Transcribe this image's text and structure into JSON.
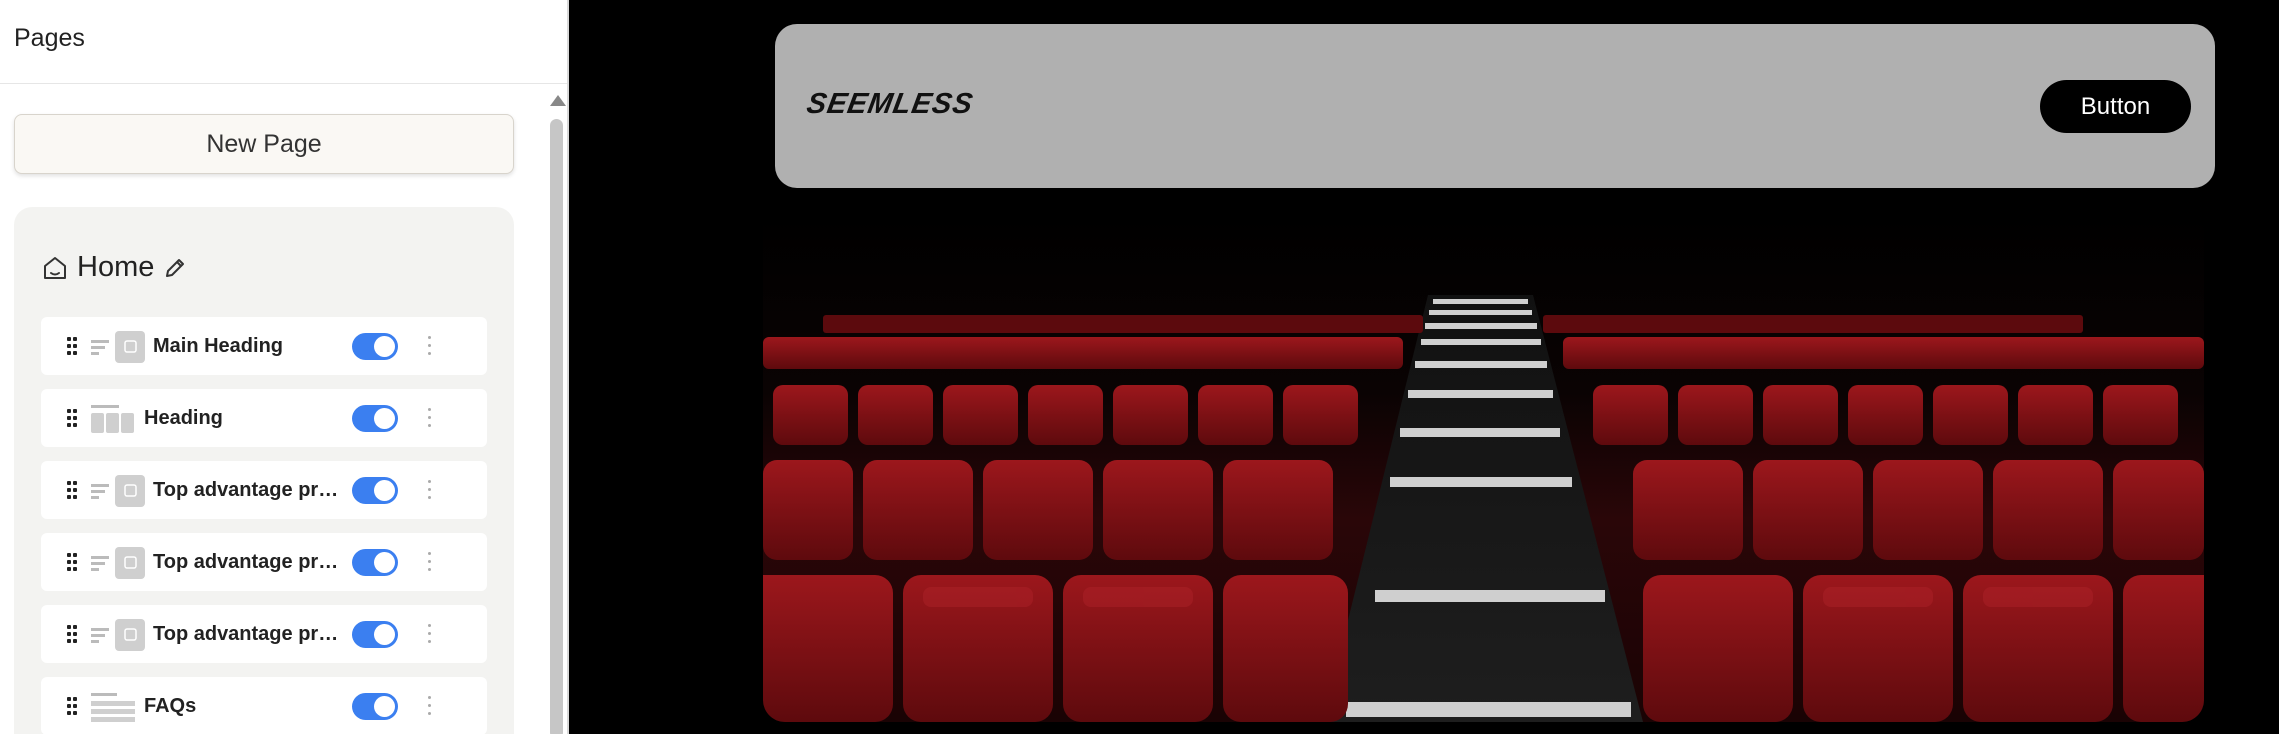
{
  "sidebar": {
    "title": "Pages",
    "new_page_label": "New Page",
    "home": {
      "label": "Home",
      "sections": [
        {
          "label": "Main Heading",
          "enabled": true,
          "thumb": "text-image"
        },
        {
          "label": "Heading",
          "enabled": true,
          "thumb": "cards"
        },
        {
          "label": "Top advantage prov…",
          "enabled": true,
          "thumb": "text-image"
        },
        {
          "label": "Top advantage prov…",
          "enabled": true,
          "thumb": "text-image"
        },
        {
          "label": "Top advantage prov…",
          "enabled": true,
          "thumb": "text-image"
        },
        {
          "label": "FAQs",
          "enabled": true,
          "thumb": "list"
        }
      ]
    }
  },
  "preview": {
    "brand": "SEEMLESS",
    "nav_button_label": "Button",
    "hero_image": "theater-red-seats-image"
  },
  "colors": {
    "toggle_on": "#3b7ff0",
    "navbar_bg": "#b0b0b0",
    "seat_red": "#8e1418"
  }
}
